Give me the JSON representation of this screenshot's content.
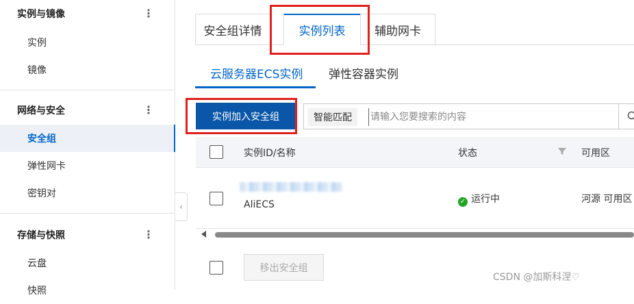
{
  "sidebar": {
    "groups": [
      {
        "title": "实例与镜像",
        "items": [
          "实例",
          "镜像"
        ]
      },
      {
        "title": "网络与安全",
        "items": [
          "安全组",
          "弹性网卡",
          "密钥对"
        ]
      },
      {
        "title": "存储与快照",
        "items": [
          "云盘",
          "快照"
        ]
      }
    ],
    "active_item": "安全组",
    "menu_icon": "⋮",
    "collapse_icon": "‹"
  },
  "tabs": [
    "安全组详情",
    "实例列表",
    "辅助网卡"
  ],
  "active_tab": "实例列表",
  "subtabs": [
    "云服务器ECS实例",
    "弹性容器实例"
  ],
  "active_subtab": "云服务器ECS实例",
  "toolbar": {
    "add_button": "实例加入安全组",
    "search_mode": "智能匹配",
    "search_placeholder": "请输入您要搜索的内容"
  },
  "table": {
    "columns": [
      "实例ID/名称",
      "状态",
      "可用区"
    ],
    "rows": [
      {
        "name": "AliECS",
        "status": "运行中",
        "zone": "河源 可用区"
      }
    ]
  },
  "footer": {
    "remove_button": "移出安全组"
  },
  "watermark": "CSDN @加斯科涅♡",
  "colors": {
    "accent": "#0064c8",
    "primary_button": "#0a56a8",
    "highlight": "#e0201b",
    "running": "#23a523"
  }
}
